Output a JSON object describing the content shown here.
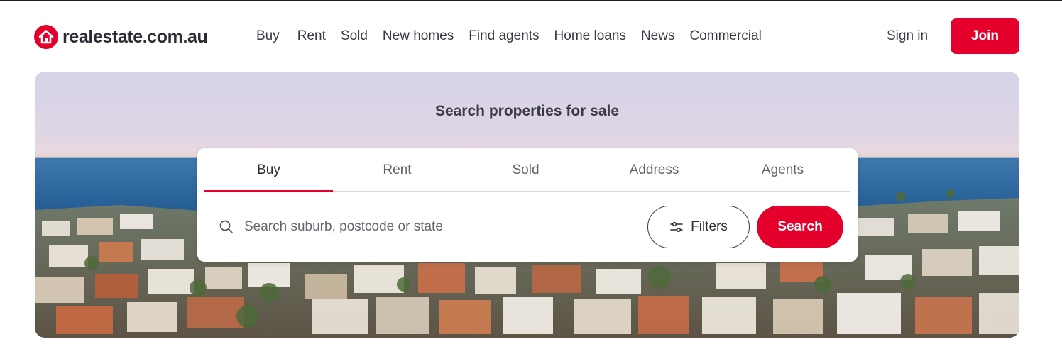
{
  "brand": {
    "name": "realestate.com.au",
    "color": "#e4002b"
  },
  "nav": {
    "items": [
      "Buy",
      "Rent",
      "Sold",
      "New homes",
      "Find agents",
      "Home loans",
      "News",
      "Commercial"
    ]
  },
  "account": {
    "signin": "Sign in",
    "join": "Join"
  },
  "hero": {
    "title": "Search properties for sale"
  },
  "search": {
    "tabs": [
      {
        "label": "Buy",
        "active": true
      },
      {
        "label": "Rent",
        "active": false
      },
      {
        "label": "Sold",
        "active": false
      },
      {
        "label": "Address",
        "active": false
      },
      {
        "label": "Agents",
        "active": false
      }
    ],
    "placeholder": "Search suburb, postcode or state",
    "value": "",
    "filters_label": "Filters",
    "submit_label": "Search",
    "icons": {
      "search": "search-icon",
      "filters": "sliders-icon"
    }
  }
}
